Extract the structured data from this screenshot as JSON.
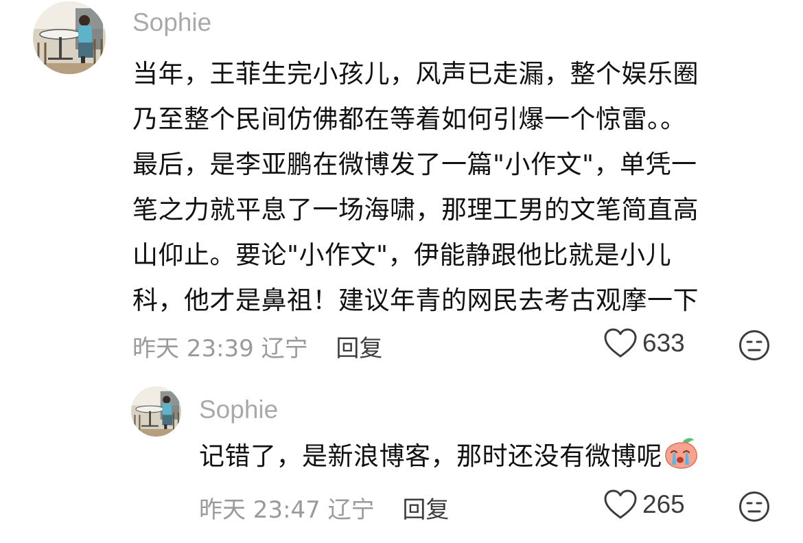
{
  "comments": [
    {
      "username": "Sophie",
      "lines": [
        "当年，王菲生完小孩儿，风声已走漏，整个娱乐圈",
        "乃至整个民间仿佛都在等着如何引爆一个惊雷。。",
        "最后，是李亚鹏在微博发了一篇\"小作文\"，单凭一",
        "笔之力就平息了一场海啸，那理工男的文笔简直高",
        "山仰止。要论\"小作文\"，伊能静跟他比就是小儿",
        "科，他才是鼻祖！建议年青的网民去考古观摩一下"
      ],
      "time": "昨天 23:39",
      "location": "辽宁",
      "reply_label": "回复",
      "likes": "633"
    },
    {
      "username": "Sophie",
      "lines": [
        "记错了，是新浪博客，那时还没有微博呢"
      ],
      "time": "昨天 23:47",
      "location": "辽宁",
      "reply_label": "回复",
      "likes": "265"
    }
  ],
  "icons": {
    "like": "heart-outline-icon",
    "dislike": "meh-face-icon",
    "emoji": "crying-peach-emoji"
  },
  "colors": {
    "username": "#a9a9a9",
    "meta": "#9a9a9a",
    "text": "#111111",
    "action": "#3c3c3c",
    "emoji_peach": "#f6a48f"
  }
}
